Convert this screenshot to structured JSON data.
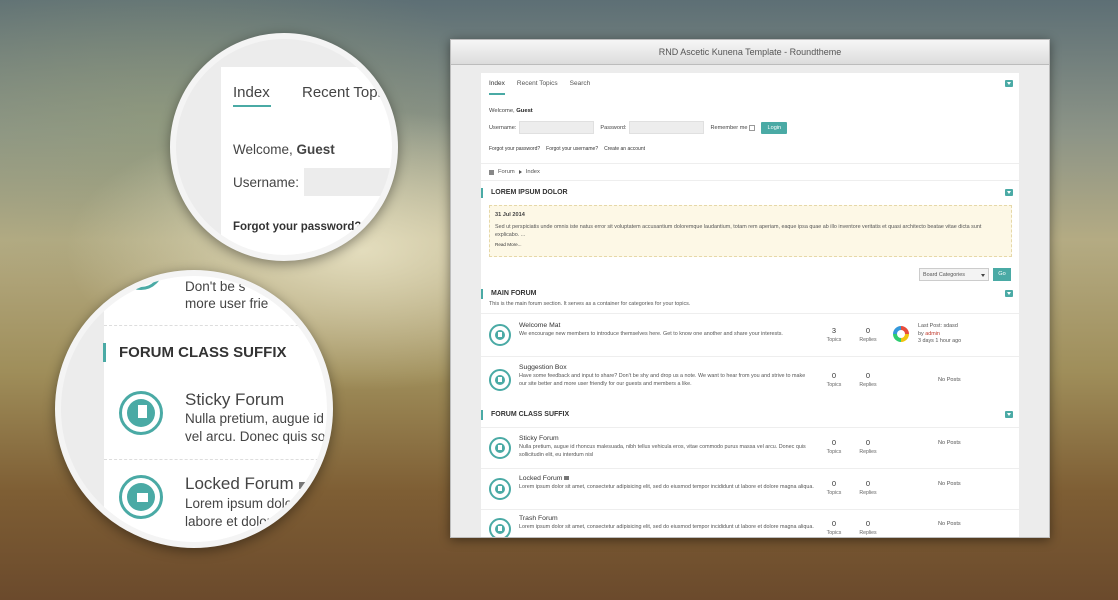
{
  "window": {
    "title": "RND Ascetic Kunena Template - Roundtheme"
  },
  "nav": {
    "tabs": [
      "Index",
      "Recent Topics",
      "Search"
    ]
  },
  "login": {
    "welcome_prefix": "Welcome,",
    "welcome_user": "Guest",
    "username_label": "Username:",
    "password_label": "Password:",
    "remember_label": "Remember me",
    "login_button": "Login",
    "links": [
      "Forgot your password?",
      "Forgot your username?",
      "Create an account"
    ]
  },
  "breadcrumb": {
    "items": [
      "Forum",
      "Index"
    ]
  },
  "announcement": {
    "heading": "LOREM IPSUM DOLOR",
    "date": "31 Jul 2014",
    "body": "Sed ut perspiciatis unde omnis iste natus error sit voluptatem accusantium doloremque laudantium, totam rem aperiam, eaque ipsa quae ab illo inventore veritatis et quasi architecto beatae vitae dicta sunt explicabo. ...",
    "read_more": "Read More..."
  },
  "board_select": {
    "value": "Board Categories",
    "go_button": "Go"
  },
  "main_forum": {
    "heading": "MAIN FORUM",
    "description": "This is the main forum section. It serves as a container for categories for your topics.",
    "forums": [
      {
        "title": "Welcome Mat",
        "desc": "We encourage new members to introduce themselves here. Get to know one another and share your interests.",
        "topics": "3",
        "replies": "0",
        "last_post_title": "Last Post: sdasd",
        "last_post_by": "by",
        "last_post_user": "admin",
        "last_post_time": "3 days 1 hour ago"
      },
      {
        "title": "Suggestion Box",
        "desc": "Have some feedback and input to share? Don't be shy and drop us a note. We want to hear from you and strive to make our site better and more user friendly for our guests and members a like.",
        "topics": "0",
        "replies": "0",
        "no_posts": "No Posts"
      }
    ]
  },
  "class_suffix": {
    "heading": "FORUM CLASS SUFFIX",
    "forums": [
      {
        "title": "Sticky Forum",
        "desc": "Nulla pretium, augue id rhoncus malesuada, nibh tellus vehicula eros, vitae commodo purus massa vel arcu. Donec quis sollicitudin elit, eu interdum nisl",
        "topics": "0",
        "replies": "0",
        "no_posts": "No Posts"
      },
      {
        "title": "Locked Forum",
        "desc": "Lorem ipsum dolor sit amet, consectetur adipisicing elit, sed do eiusmod tempor incididunt ut labore et dolore magna aliqua.",
        "topics": "0",
        "replies": "0",
        "no_posts": "No Posts"
      },
      {
        "title": "Trash Forum",
        "desc": "Lorem ipsum dolor sit amet, consectetur adipisicing elit, sed do eiusmod tempor incididunt ut labore et dolore magna aliqua.",
        "topics": "0",
        "replies": "0",
        "no_posts": "No Posts"
      }
    ]
  },
  "labels": {
    "topics": "Topics",
    "replies": "Replies"
  },
  "zoom1": {
    "tab_index": "Index",
    "tab_recent": "Recent Topi",
    "welcome_prefix": "Welcome,",
    "welcome_user": "Guest",
    "username_label": "Username:",
    "forgot": "Forgot your password?"
  },
  "zoom2": {
    "top_line1": "Don't be s",
    "top_line2": "more user frie",
    "heading": "FORUM CLASS SUFFIX",
    "sticky_title": "Sticky Forum",
    "sticky_line1": "Nulla pretium, augue id",
    "sticky_line2": "vel arcu. Donec quis so",
    "locked_title": "Locked Forum",
    "locked_line1": "Lorem ipsum dolo",
    "locked_line2": "labore et dolor"
  },
  "colors": {
    "accent": "#4aaaa5",
    "announce_bg": "#fdf8e6",
    "admin": "#c0392b"
  }
}
